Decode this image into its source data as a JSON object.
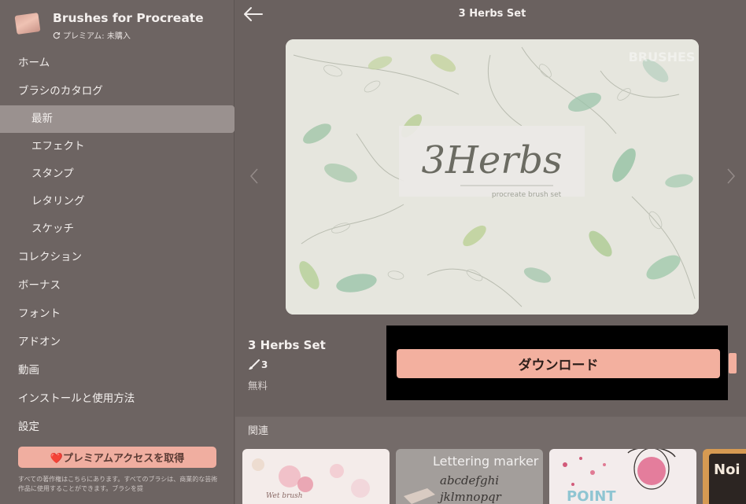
{
  "app": {
    "title": "Brushes for Procreate",
    "subscription": "プレミアム: 未購入"
  },
  "sidebar": {
    "items": [
      {
        "label": "ホーム",
        "level": 0
      },
      {
        "label": "ブラシのカタログ",
        "level": 0
      },
      {
        "label": "最新",
        "level": 1,
        "active": true
      },
      {
        "label": "エフェクト",
        "level": 1
      },
      {
        "label": "スタンプ",
        "level": 1
      },
      {
        "label": "レタリング",
        "level": 1
      },
      {
        "label": "スケッチ",
        "level": 1
      },
      {
        "label": "コレクション",
        "level": 0
      },
      {
        "label": "ボーナス",
        "level": 0
      },
      {
        "label": "フォント",
        "level": 0
      },
      {
        "label": "アドオン",
        "level": 0
      },
      {
        "label": "動画",
        "level": 0
      },
      {
        "label": "インストールと使用方法",
        "level": 0
      },
      {
        "label": "設定",
        "level": 0
      }
    ],
    "premium_button": "❤️プレミアムアクセスを取得",
    "footer_note": "すべての著作権はこちらにあります。すべてのブラシは、商業的な芸術作品に使用することができます。ブラシを提"
  },
  "header": {
    "title": "3 Herbs Set"
  },
  "hero": {
    "title_text": "3Herbs",
    "subtitle_text": "procreate brush set",
    "watermark": "BRUSHES"
  },
  "product": {
    "name": "3 Herbs Set",
    "brush_count": "3",
    "price": "無料",
    "download_label": "ダウンロード"
  },
  "related": {
    "title": "関連",
    "thumbs": [
      {
        "caption": "Wet brush"
      },
      {
        "caption": "Lettering marker",
        "letters1": "abcdefghi",
        "letters2": "jklmnopqr"
      },
      {
        "caption": "POINT"
      },
      {
        "caption": "Noi"
      }
    ]
  },
  "colors": {
    "accent": "#f3b09f",
    "sidebar_bg": "#6d6462",
    "main_bg": "#6a615f",
    "active_item": "#9a918f"
  }
}
